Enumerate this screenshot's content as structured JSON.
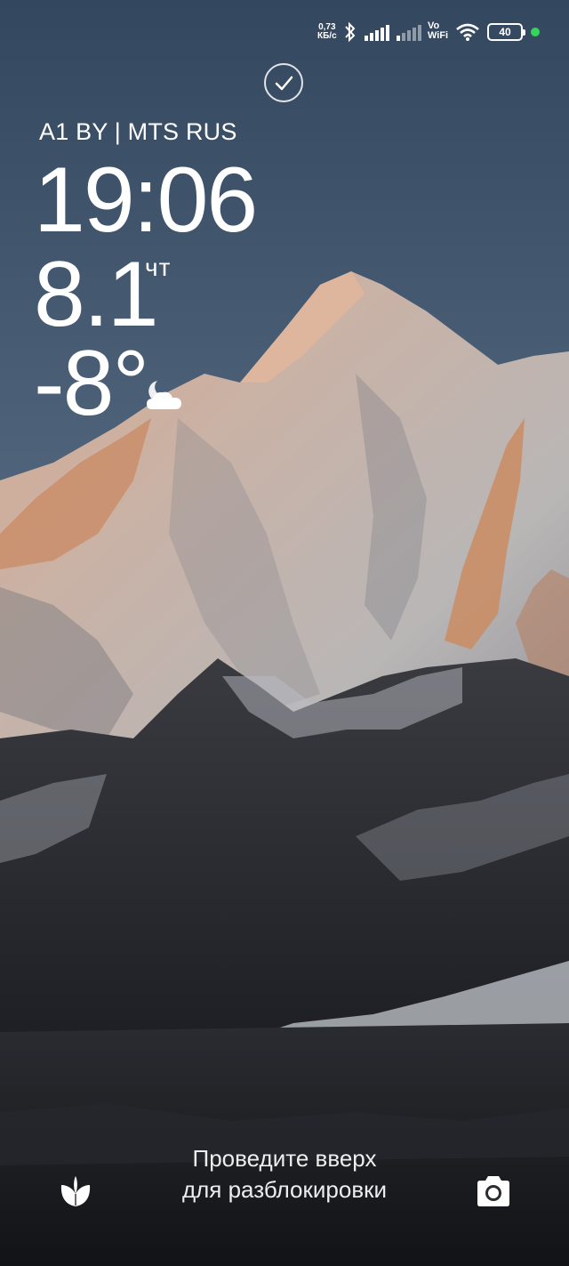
{
  "status_bar": {
    "net_speed_value": "0,73",
    "net_speed_unit": "КБ/с",
    "vowifi_top": "Vo",
    "vowifi_bottom": "WiFi",
    "battery_level": "40",
    "icons": [
      "bluetooth-icon",
      "signal-icon",
      "signal-icon",
      "vowifi-icon",
      "wifi-icon",
      "battery-icon",
      "camera-in-use-dot"
    ],
    "dot_color": "#35d45a"
  },
  "lockscreen": {
    "carrier": "A1 BY | MTS RUS",
    "time": "19:06",
    "date": "8.1",
    "day_of_week": "чт",
    "temperature": "-8°",
    "weather_icon": "partly-cloudy-night-icon",
    "unlock_line1": "Проведите вверх",
    "unlock_line2": "для разблокировки",
    "left_shortcut_icon": "leaf-icon",
    "right_shortcut_icon": "camera-icon"
  }
}
